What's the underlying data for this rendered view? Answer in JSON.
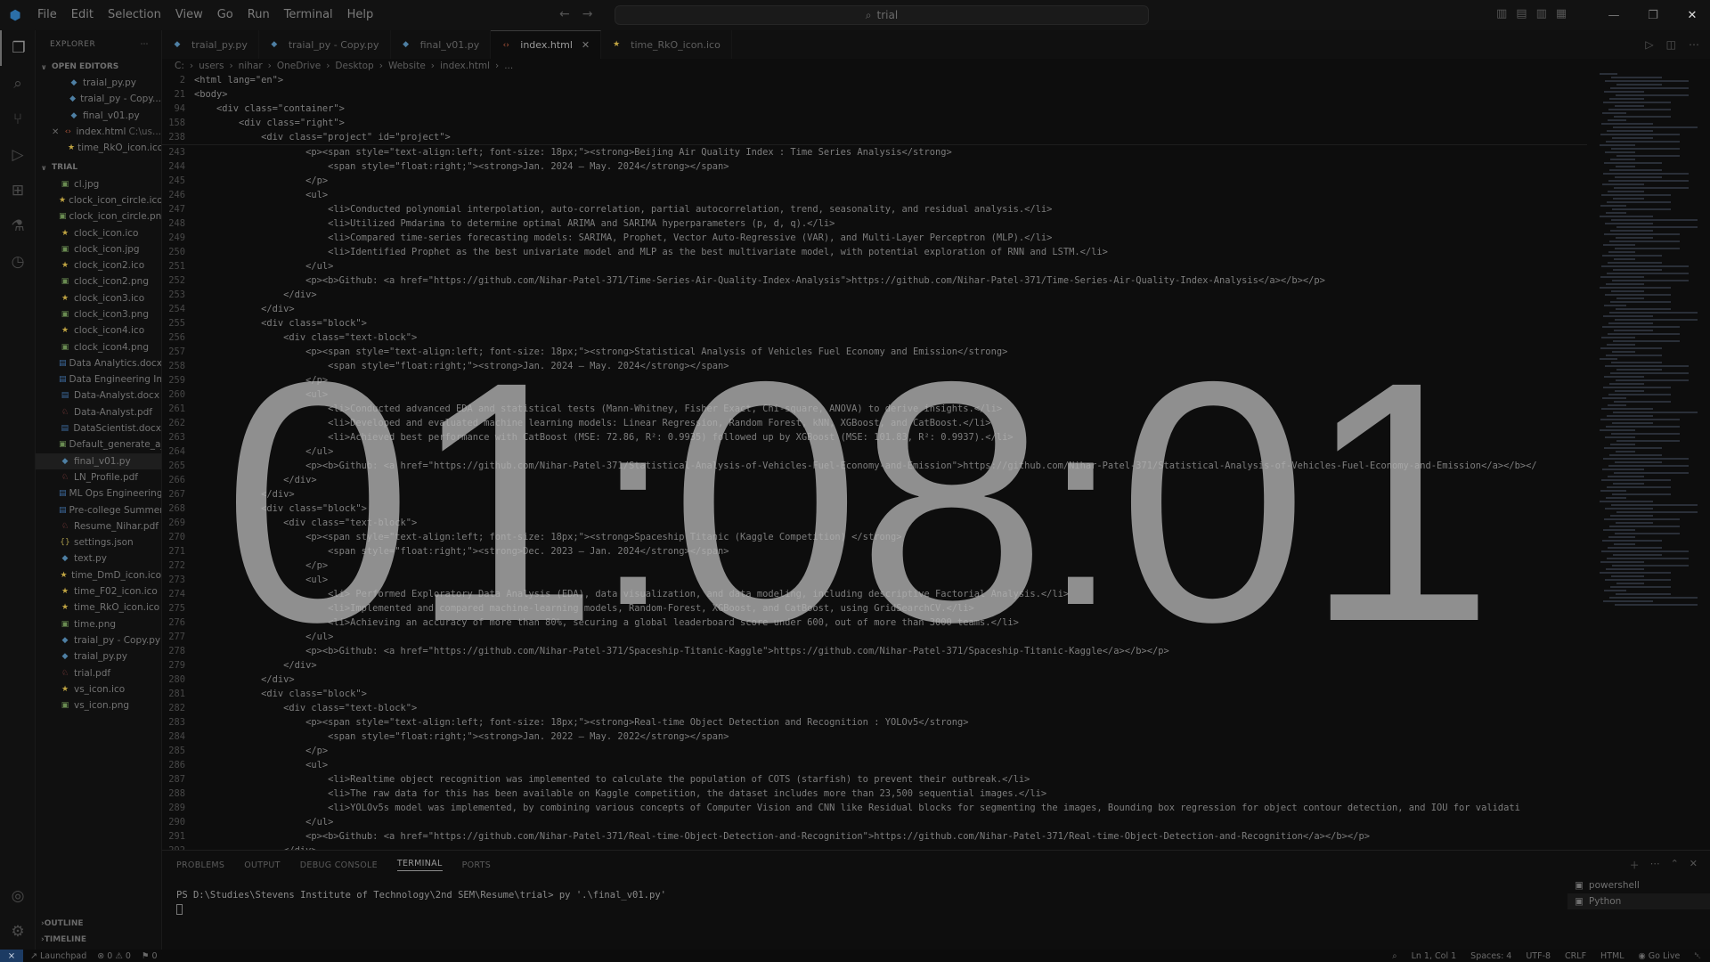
{
  "titlebar": {
    "menu": [
      "File",
      "Edit",
      "Selection",
      "View",
      "Go",
      "Run",
      "Terminal",
      "Help"
    ],
    "search": "trial"
  },
  "sidebar": {
    "title": "EXPLORER",
    "open_editors_label": "OPEN EDITORS",
    "open_editors": [
      {
        "name": "traial_py.py",
        "icon": "python-file-icon",
        "color": "c-py"
      },
      {
        "name": "traial_py - Copy...",
        "icon": "python-file-icon",
        "color": "c-py"
      },
      {
        "name": "final_v01.py",
        "icon": "python-file-icon",
        "color": "c-py"
      },
      {
        "name": "index.html",
        "dim": "C:\\us...",
        "icon": "html-file-icon",
        "color": "c-html",
        "close": true
      },
      {
        "name": "time_RkO_icon.ico",
        "icon": "ico-file-icon",
        "color": "c-ico"
      }
    ],
    "folder_label": "TRIAL",
    "files": [
      {
        "name": "cl.jpg",
        "icon": "image-file-icon",
        "color": "c-img"
      },
      {
        "name": "clock_icon_circle.ico",
        "icon": "ico-file-icon",
        "color": "c-ico"
      },
      {
        "name": "clock_icon_circle.png",
        "icon": "image-file-icon",
        "color": "c-img"
      },
      {
        "name": "clock_icon.ico",
        "icon": "ico-file-icon",
        "color": "c-ico"
      },
      {
        "name": "clock_icon.jpg",
        "icon": "image-file-icon",
        "color": "c-img"
      },
      {
        "name": "clock_icon2.ico",
        "icon": "ico-file-icon",
        "color": "c-ico"
      },
      {
        "name": "clock_icon2.png",
        "icon": "image-file-icon",
        "color": "c-img"
      },
      {
        "name": "clock_icon3.ico",
        "icon": "ico-file-icon",
        "color": "c-ico"
      },
      {
        "name": "clock_icon3.png",
        "icon": "image-file-icon",
        "color": "c-img"
      },
      {
        "name": "clock_icon4.ico",
        "icon": "ico-file-icon",
        "color": "c-ico"
      },
      {
        "name": "clock_icon4.png",
        "icon": "image-file-icon",
        "color": "c-img"
      },
      {
        "name": "Data Analytics.docx",
        "icon": "word-file-icon",
        "color": "c-doc"
      },
      {
        "name": "Data Engineering Inte...",
        "icon": "word-file-icon",
        "color": "c-doc"
      },
      {
        "name": "Data-Analyst.docx",
        "icon": "word-file-icon",
        "color": "c-doc"
      },
      {
        "name": "Data-Analyst.pdf",
        "icon": "pdf-file-icon",
        "color": "c-pdf"
      },
      {
        "name": "DataScientist.docx",
        "icon": "word-file-icon",
        "color": "c-doc"
      },
      {
        "name": "Default_generate_a_v...",
        "icon": "image-file-icon",
        "color": "c-img"
      },
      {
        "name": "final_v01.py",
        "icon": "python-file-icon",
        "color": "c-py",
        "selected": true
      },
      {
        "name": "LN_Profile.pdf",
        "icon": "pdf-file-icon",
        "color": "c-pdf"
      },
      {
        "name": "ML Ops Engineering...",
        "icon": "word-file-icon",
        "color": "c-doc"
      },
      {
        "name": "Pre-college Summer ...",
        "icon": "word-file-icon",
        "color": "c-doc"
      },
      {
        "name": "Resume_Nihar.pdf",
        "icon": "pdf-file-icon",
        "color": "c-pdf"
      },
      {
        "name": "settings.json",
        "icon": "json-file-icon",
        "color": "c-json"
      },
      {
        "name": "text.py",
        "icon": "python-file-icon",
        "color": "c-py"
      },
      {
        "name": "time_DmD_icon.ico",
        "icon": "ico-file-icon",
        "color": "c-ico"
      },
      {
        "name": "time_F02_icon.ico",
        "icon": "ico-file-icon",
        "color": "c-ico"
      },
      {
        "name": "time_RkO_icon.ico",
        "icon": "ico-file-icon",
        "color": "c-ico"
      },
      {
        "name": "time.png",
        "icon": "image-file-icon",
        "color": "c-img"
      },
      {
        "name": "traial_py - Copy.py",
        "icon": "python-file-icon",
        "color": "c-py"
      },
      {
        "name": "traial_py.py",
        "icon": "python-file-icon",
        "color": "c-py"
      },
      {
        "name": "trial.pdf",
        "icon": "pdf-file-icon",
        "color": "c-pdf"
      },
      {
        "name": "vs_icon.ico",
        "icon": "ico-file-icon",
        "color": "c-ico"
      },
      {
        "name": "vs_icon.png",
        "icon": "image-file-icon",
        "color": "c-img"
      }
    ],
    "outline_label": "OUTLINE",
    "timeline_label": "TIMELINE"
  },
  "tabs": [
    {
      "label": "traial_py.py",
      "color": "c-py"
    },
    {
      "label": "traial_py - Copy.py",
      "color": "c-py"
    },
    {
      "label": "final_v01.py",
      "color": "c-py"
    },
    {
      "label": "index.html",
      "color": "c-html",
      "active": true
    },
    {
      "label": "time_RkO_icon.ico",
      "color": "c-ico"
    }
  ],
  "breadcrumb": [
    "C:",
    "users",
    "nihar",
    "OneDrive",
    "Desktop",
    "Website",
    "index.html",
    "..."
  ],
  "sticky_lines": [
    {
      "n": "2",
      "t": "<html lang=\"en\">"
    },
    {
      "n": "21",
      "t": "<body>"
    },
    {
      "n": "94",
      "t": "    <div class=\"container\">"
    },
    {
      "n": "158",
      "t": "        <div class=\"right\">"
    },
    {
      "n": "238",
      "t": "            <div class=\"project\" id=\"project\">"
    }
  ],
  "code_lines": [
    {
      "n": "243",
      "t": "                    <p><span style=\"text-align:left; font-size: 18px;\"><strong>Beijing Air Quality Index : Time Series Analysis</strong>"
    },
    {
      "n": "244",
      "t": "                        <span style=\"float:right;\"><strong>Jan. 2024 – May. 2024</strong></span>"
    },
    {
      "n": "245",
      "t": "                    </p>"
    },
    {
      "n": "246",
      "t": "                    <ul>"
    },
    {
      "n": "247",
      "t": "                        <li>Conducted polynomial interpolation, auto-correlation, partial autocorrelation, trend, seasonality, and residual analysis.</li>"
    },
    {
      "n": "248",
      "t": "                        <li>Utilized Pmdarima to determine optimal ARIMA and SARIMA hyperparameters (p, d, q).</li>"
    },
    {
      "n": "249",
      "t": "                        <li>Compared time-series forecasting models: SARIMA, Prophet, Vector Auto-Regressive (VAR), and Multi-Layer Perceptron (MLP).</li>"
    },
    {
      "n": "250",
      "t": "                        <li>Identified Prophet as the best univariate model and MLP as the best multivariate model, with potential exploration of RNN and LSTM.</li>"
    },
    {
      "n": "251",
      "t": "                    </ul>"
    },
    {
      "n": "252",
      "t": "                    <p><b>Github: <a href=\"https://github.com/Nihar-Patel-371/Time-Series-Air-Quality-Index-Analysis\">https://github.com/Nihar-Patel-371/Time-Series-Air-Quality-Index-Analysis</a></b></p>"
    },
    {
      "n": "253",
      "t": "                </div>"
    },
    {
      "n": "254",
      "t": "            </div>"
    },
    {
      "n": "255",
      "t": "            <div class=\"block\">"
    },
    {
      "n": "256",
      "t": "                <div class=\"text-block\">"
    },
    {
      "n": "257",
      "t": "                    <p><span style=\"text-align:left; font-size: 18px;\"><strong>Statistical Analysis of Vehicles Fuel Economy and Emission</strong>"
    },
    {
      "n": "258",
      "t": "                        <span style=\"float:right;\"><strong>Jan. 2024 – May. 2024</strong></span>"
    },
    {
      "n": "259",
      "t": "                    </p>"
    },
    {
      "n": "260",
      "t": "                    <ul>"
    },
    {
      "n": "261",
      "t": "                        <li>Conducted advanced EDA and statistical tests (Mann-Whitney, Fisher Exact, Chi-square, ANOVA) to derive insights.</li>"
    },
    {
      "n": "262",
      "t": "                        <li>Developed and evaluated machine learning models: Linear Regression, Random Forest, kNN, XGBoost, and CatBoost.</li>"
    },
    {
      "n": "263",
      "t": "                        <li>Achieved best performance with CatBoost (MSE: 72.86, R²: 0.9935) followed up by XGBoost (MSE: 101.83, R²: 0.9937).</li>"
    },
    {
      "n": "264",
      "t": "                    </ul>"
    },
    {
      "n": "265",
      "t": "                    <p><b>Github: <a href=\"https://github.com/Nihar-Patel-371/Statistical-Analysis-of-Vehicles-Fuel-Economy-and-Emission\">https://github.com/Nihar-Patel-371/Statistical-Analysis-of-Vehicles-Fuel-Economy-and-Emission</a></b></"
    },
    {
      "n": "266",
      "t": "                </div>"
    },
    {
      "n": "267",
      "t": "            </div>"
    },
    {
      "n": "268",
      "t": "            <div class=\"block\">"
    },
    {
      "n": "269",
      "t": "                <div class=\"text-block\">"
    },
    {
      "n": "270",
      "t": "                    <p><span style=\"text-align:left; font-size: 18px;\"><strong>Spaceship Titanic (Kaggle Competition) </strong>"
    },
    {
      "n": "271",
      "t": "                        <span style=\"float:right;\"><strong>Dec. 2023 – Jan. 2024</strong></span>"
    },
    {
      "n": "272",
      "t": "                    </p>"
    },
    {
      "n": "273",
      "t": "                    <ul>"
    },
    {
      "n": "274",
      "t": "                        <li> Performed Exploratory Data Analysis (EDA), data visualization, and data modeling, including descriptive Factorial Analysis.</li>"
    },
    {
      "n": "275",
      "t": "                        <li>Implemented and compared machine-learning models, Random-Forest, XGBoost, and CatBoost, using GridSearchCV.</li>"
    },
    {
      "n": "276",
      "t": "                        <li>Achieving an accuracy of more than 80%, securing a global leaderboard score under 600, out of more than 3000 teams.</li>"
    },
    {
      "n": "277",
      "t": "                    </ul>"
    },
    {
      "n": "278",
      "t": "                    <p><b>Github: <a href=\"https://github.com/Nihar-Patel-371/Spaceship-Titanic-Kaggle\">https://github.com/Nihar-Patel-371/Spaceship-Titanic-Kaggle</a></b></p>"
    },
    {
      "n": "279",
      "t": "                </div>"
    },
    {
      "n": "280",
      "t": "            </div>"
    },
    {
      "n": "281",
      "t": "            <div class=\"block\">"
    },
    {
      "n": "282",
      "t": "                <div class=\"text-block\">"
    },
    {
      "n": "283",
      "t": "                    <p><span style=\"text-align:left; font-size: 18px;\"><strong>Real-time Object Detection and Recognition : YOLOv5</strong>"
    },
    {
      "n": "284",
      "t": "                        <span style=\"float:right;\"><strong>Jan. 2022 – May. 2022</strong></span>"
    },
    {
      "n": "285",
      "t": "                    </p>"
    },
    {
      "n": "286",
      "t": "                    <ul>"
    },
    {
      "n": "287",
      "t": "                        <li>Realtime object recognition was implemented to calculate the population of COTS (starfish) to prevent their outbreak.</li>"
    },
    {
      "n": "288",
      "t": "                        <li>The raw data for this has been available on Kaggle competition, the dataset includes more than 23,500 sequential images.</li>"
    },
    {
      "n": "289",
      "t": "                        <li>YOLOv5s model was implemented, by combining various concepts of Computer Vision and CNN like Residual blocks for segmenting the images, Bounding box regression for object contour detection, and IOU for validati"
    },
    {
      "n": "290",
      "t": "                    </ul>"
    },
    {
      "n": "291",
      "t": "                    <p><b>Github: <a href=\"https://github.com/Nihar-Patel-371/Real-time-Object-Detection-and-Recognition\">https://github.com/Nihar-Patel-371/Real-time-Object-Detection-and-Recognition</a></b></p>"
    },
    {
      "n": "292",
      "t": "                </div>"
    }
  ],
  "panel": {
    "tabs": [
      "PROBLEMS",
      "OUTPUT",
      "DEBUG CONSOLE",
      "TERMINAL",
      "PORTS"
    ],
    "active_tab": "TERMINAL",
    "terminal_line": "PS D:\\Studies\\Stevens Institute of Technology\\2nd SEM\\Resume\\trial> py '.\\final_v01.py'",
    "terminals": [
      "powershell",
      "Python"
    ]
  },
  "statusbar": {
    "launchpad": "Launchpad",
    "errors": "0",
    "warnings": "0",
    "ports": "0",
    "position": "Ln 1, Col 1",
    "spaces": "Spaces: 4",
    "encoding": "UTF-8",
    "eol": "CRLF",
    "language": "HTML",
    "golive": "Go Live"
  },
  "clock": {
    "hours": "01",
    "minutes": "08",
    "seconds": "01",
    "color": "#b4b4b4"
  }
}
